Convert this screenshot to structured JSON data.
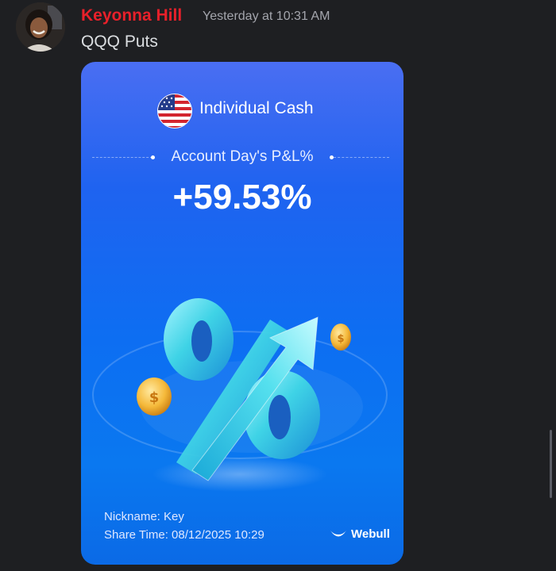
{
  "message": {
    "author": "Keyonna Hill",
    "author_color": "#e8202a",
    "timestamp": "Yesterday at 10:31 AM",
    "text": "QQQ Puts",
    "avatar_icon": "user-avatar"
  },
  "card": {
    "flag_icon": "us-flag-icon",
    "account_type": "Individual Cash",
    "pnl_label": "Account Day's P&L%",
    "pnl_value": "+59.53%",
    "illustration": "rising-arrow-percent-coins",
    "nickname": "Nickname: Key",
    "share_time": "Share Time: 08/12/2025 10:29",
    "brand": "Webull",
    "brand_icon": "webull-logo-icon",
    "background_color": "#0d6ef2"
  },
  "theme": {
    "background": "#1e1f22",
    "text": "#dbdee1",
    "muted": "#a4a6ad"
  }
}
